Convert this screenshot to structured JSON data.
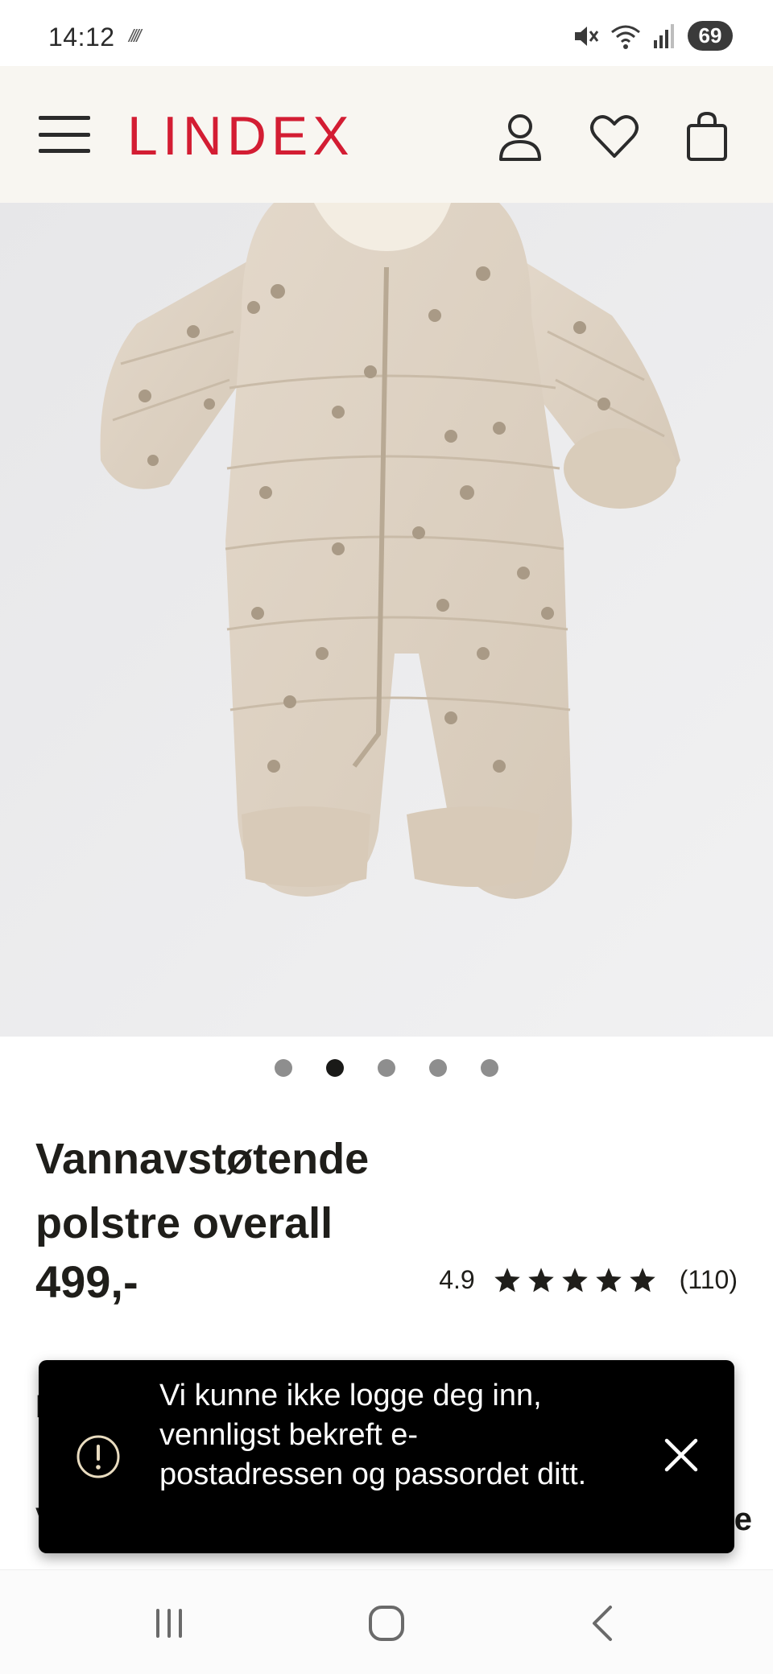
{
  "status_bar": {
    "time": "14:12",
    "extra": "////",
    "battery": "69"
  },
  "header": {
    "logo": "LINDEX",
    "brand_color": "#d31d33",
    "icons": [
      "menu-icon",
      "user-icon",
      "heart-icon",
      "bag-icon"
    ]
  },
  "gallery": {
    "image_count": 5,
    "active_index": 1
  },
  "product": {
    "title": "Vannavstøtende polstre overall",
    "price": "499,-",
    "rating_score": "4.9",
    "rating_stars": 5,
    "rating_count": "(110)"
  },
  "partial": {
    "line_a": "I",
    "line_b": "V",
    "line_c": "e"
  },
  "toast": {
    "message": "Vi kunne ikke logge deg inn, vennligst bekreft e-postadressen og passordet ditt.",
    "icon": "alert-circle-icon",
    "accent_color": "#e9dcc0"
  },
  "system_nav": {
    "buttons": [
      "recents-icon",
      "home-icon",
      "back-icon"
    ]
  }
}
